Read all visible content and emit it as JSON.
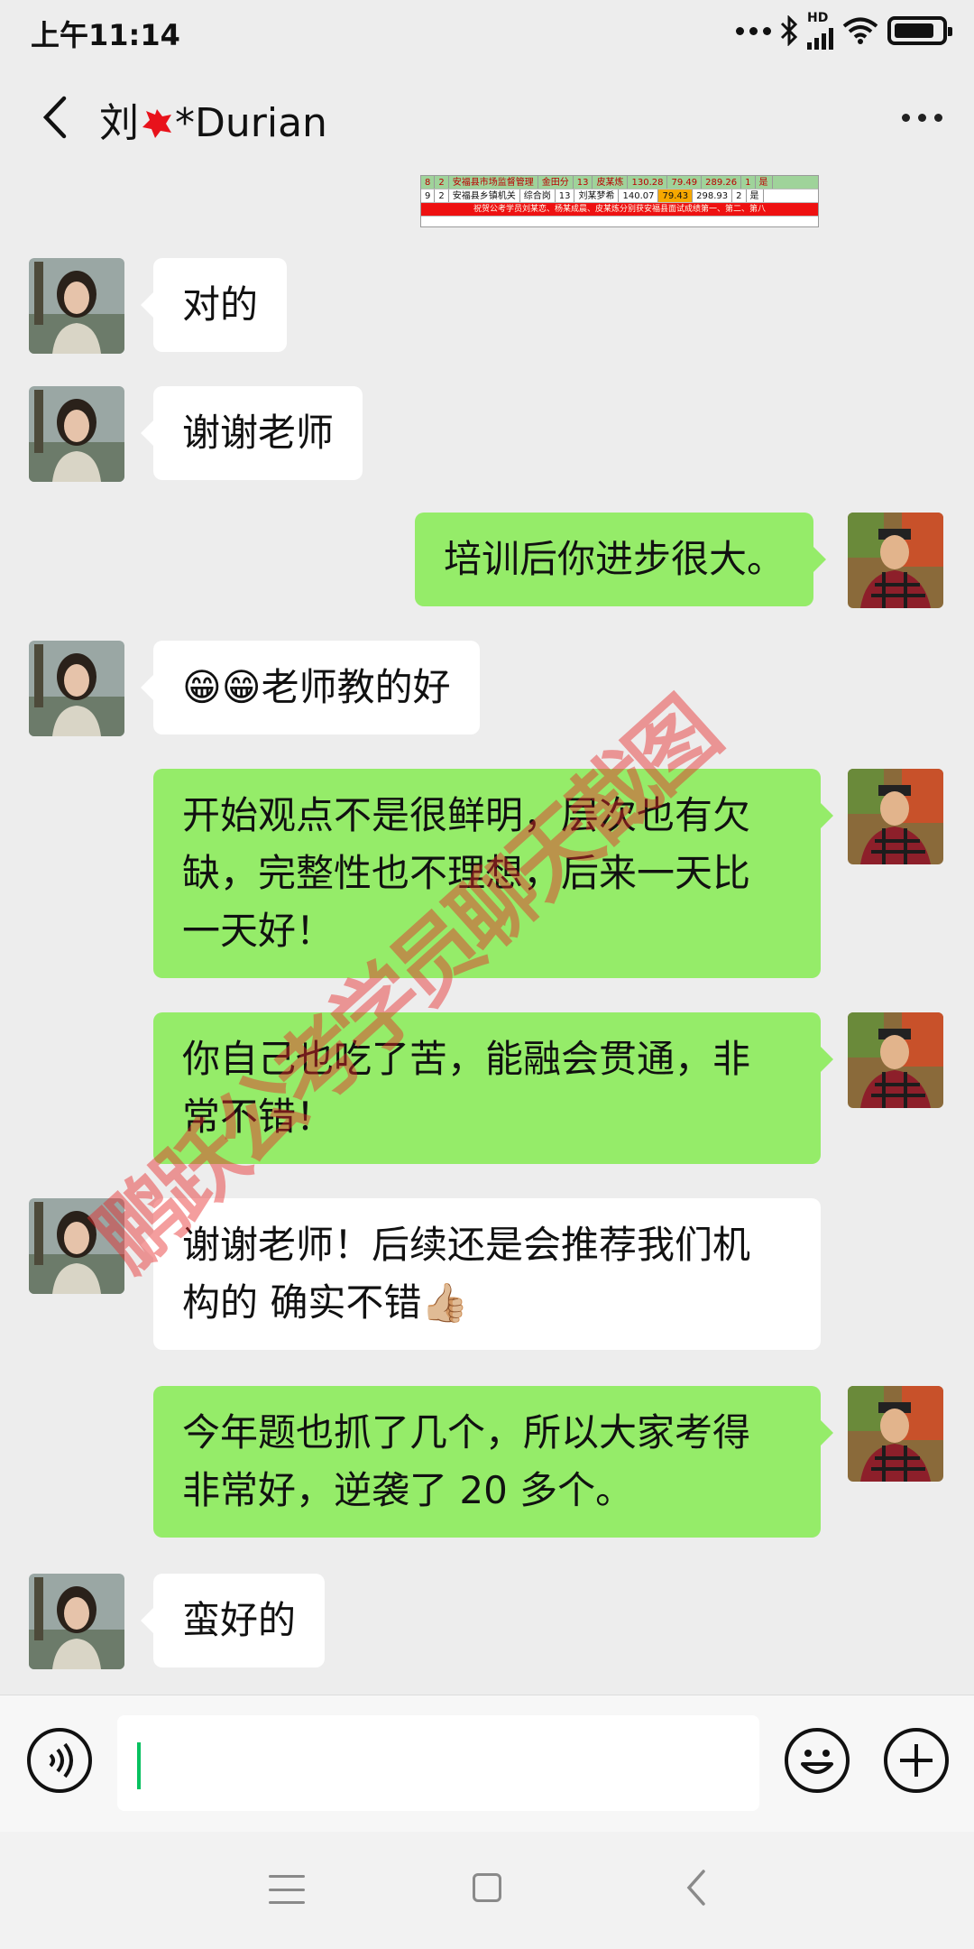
{
  "status_bar": {
    "time": "上午11:14",
    "network": "HD",
    "icons": [
      "dots-icon",
      "bluetooth-icon",
      "signal-icon",
      "wifi-icon",
      "battery-icon"
    ]
  },
  "header": {
    "title": "刘",
    "title_suffix": "*Durian",
    "back_icon": "chevron-left-icon",
    "more_icon": "more-dots-icon"
  },
  "shared_image": {
    "rows": [
      [
        "8",
        "2",
        "安福县市场监督管理",
        "金田分",
        "13",
        "皮某炼",
        "130.28",
        "79.49",
        "289.26",
        "1",
        "是"
      ],
      [
        "9",
        "2",
        "安福县乡镇机关",
        "综合岗",
        "13",
        "刘某梦希",
        "140.07",
        "79.43",
        "298.93",
        "2",
        "是"
      ],
      [
        "祝贺公考学员刘某恋、杨某成晨、皮某炼分别获安福县面试成绩第一、第二、第八"
      ]
    ]
  },
  "messages": [
    {
      "side": "in",
      "text": "对的"
    },
    {
      "side": "in",
      "text": "谢谢老师"
    },
    {
      "side": "out",
      "text": "培训后你进步很大。"
    },
    {
      "side": "in",
      "text": "😁😁老师教的好"
    },
    {
      "side": "out",
      "lines": [
        "开始观点不是很鲜明，层次也有欠",
        "缺，完整性也不理想，后来一天比",
        "一天好！"
      ]
    },
    {
      "side": "out",
      "lines": [
        "你自己也吃了苦，能融会贯通，非",
        "常不错！"
      ]
    },
    {
      "side": "in",
      "lines": [
        "谢谢老师！后续还是会推荐我们机",
        "构的 确实不错👍🏼"
      ]
    },
    {
      "side": "out",
      "lines": [
        "今年题也抓了几个，所以大家考得",
        "非常好，逆袭了 20 多个。"
      ]
    },
    {
      "side": "in",
      "text": "蛮好的"
    }
  ],
  "watermark": "鹏跃公考学员聊天截图",
  "input_bar": {
    "placeholder": "",
    "voice_icon": "voice-icon",
    "emoji_icon": "emoji-icon",
    "plus_icon": "plus-icon"
  },
  "nav_bar": {
    "icons": [
      "menu-icon",
      "home-icon",
      "back-icon"
    ]
  },
  "colors": {
    "background": "#ededed",
    "bubble_out": "#95ec69",
    "bubble_in": "#ffffff",
    "cursor": "#07c160"
  }
}
